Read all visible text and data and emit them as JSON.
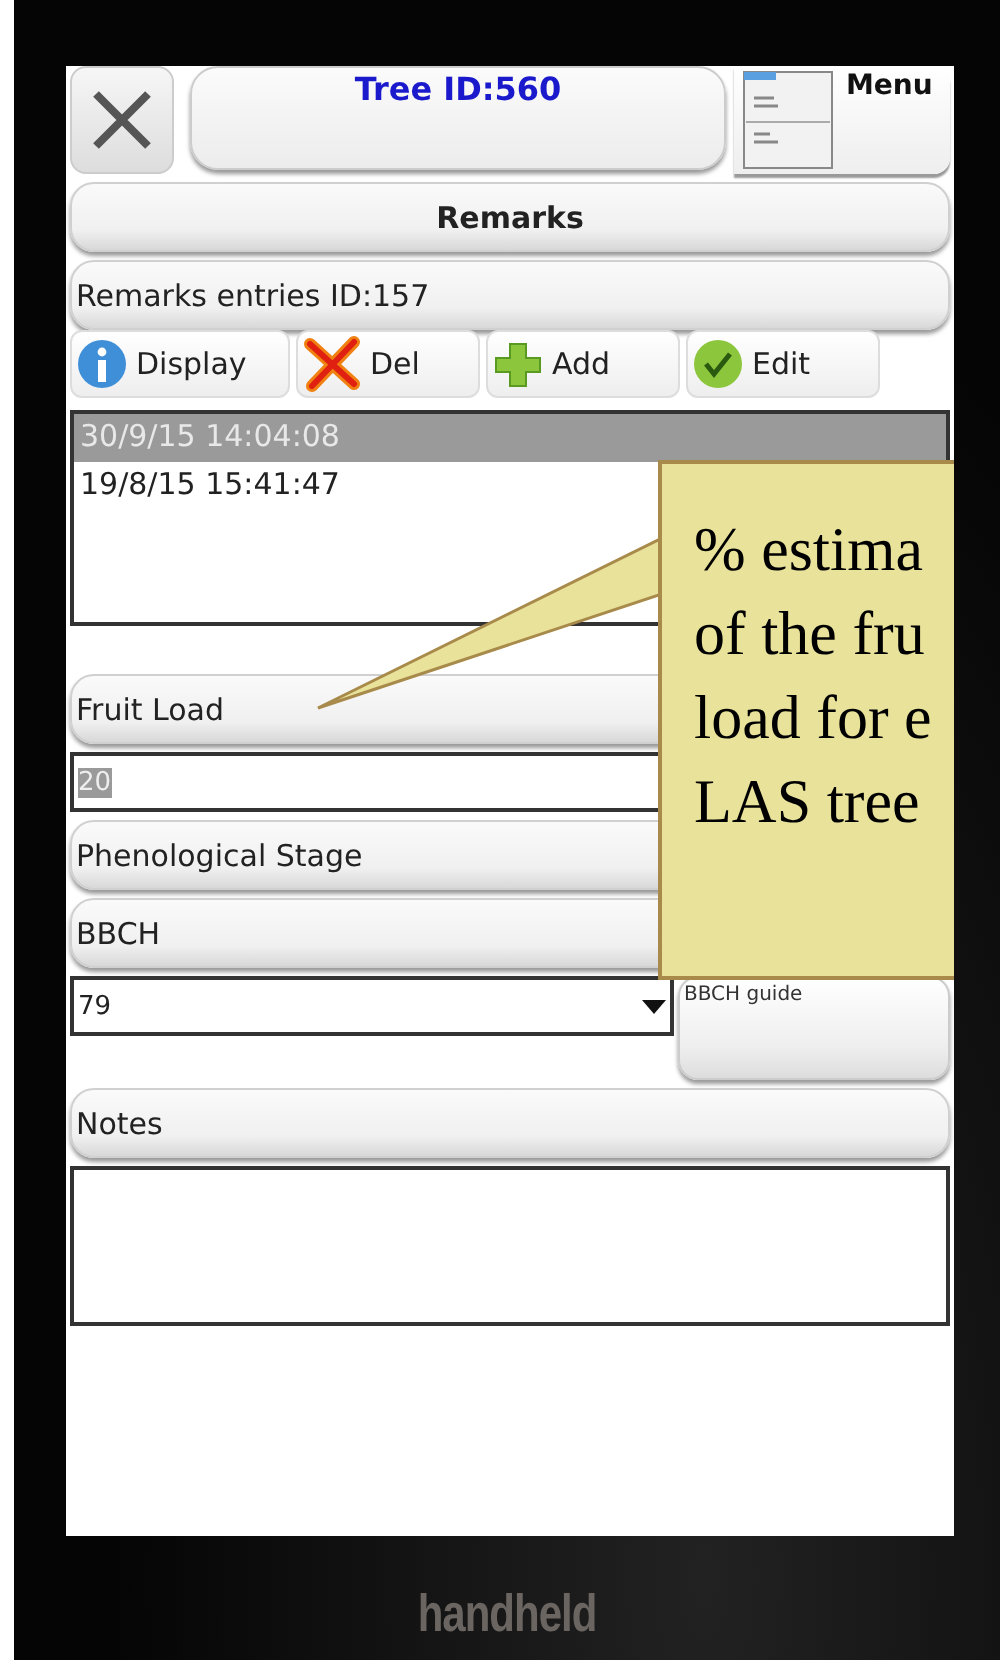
{
  "header": {
    "title": "Tree ID:560",
    "menu_label": "Menu"
  },
  "section_title": "Remarks",
  "entries_label": "Remarks entries ID:157",
  "toolbar": [
    {
      "kind": "info",
      "label": "Display"
    },
    {
      "kind": "delete",
      "label": "Del"
    },
    {
      "kind": "add",
      "label": "Add"
    },
    {
      "kind": "edit",
      "label": "Edit"
    }
  ],
  "entries": [
    {
      "text": "30/9/15 14:04:08",
      "selected": true
    },
    {
      "text": "19/8/15 15:41:47",
      "selected": false
    }
  ],
  "fruit_load": {
    "label": "Fruit Load",
    "value": "20",
    "value_selected": true
  },
  "phenological_stage": {
    "label": "Phenological Stage"
  },
  "bbch": {
    "label": "BBCH",
    "value": "79",
    "guide_button": "BBCH guide"
  },
  "notes": {
    "label": "Notes"
  },
  "device": {
    "brand": "handheld"
  },
  "callout": {
    "lines": [
      "% estima",
      "of the fru",
      "load for e",
      "LAS tree"
    ]
  }
}
